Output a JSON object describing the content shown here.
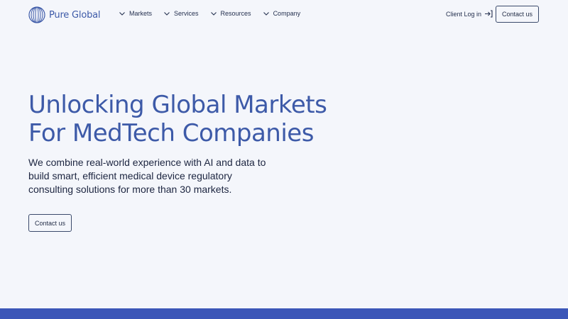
{
  "header": {
    "logo": {
      "text": "Pure Global",
      "icon": "globe-lines-icon"
    },
    "nav": [
      {
        "label": "Markets",
        "icon": "chevron-down-icon"
      },
      {
        "label": "Services",
        "icon": "chevron-down-icon"
      },
      {
        "label": "Resources",
        "icon": "chevron-down-icon"
      },
      {
        "label": "Company",
        "icon": "chevron-down-icon"
      }
    ],
    "client_login": {
      "label": "Client Log in",
      "icon": "login-arrow-icon"
    },
    "contact_button": "Contact us"
  },
  "hero": {
    "title_line1": "Unlocking Global Markets",
    "title_line2": "For MedTech Companies",
    "subtitle_line1": "We combine real-world experience with AI and data to",
    "subtitle_line2": "build smart, efficient medical device regulatory",
    "subtitle_line3": "consulting solutions for more than 30 markets.",
    "contact_button": "Contact us"
  },
  "colors": {
    "background": "#f4f6fb",
    "brand_blue": "#3d5aa8",
    "band_blue": "#3b56b8",
    "text_dark": "#1f2a44"
  }
}
